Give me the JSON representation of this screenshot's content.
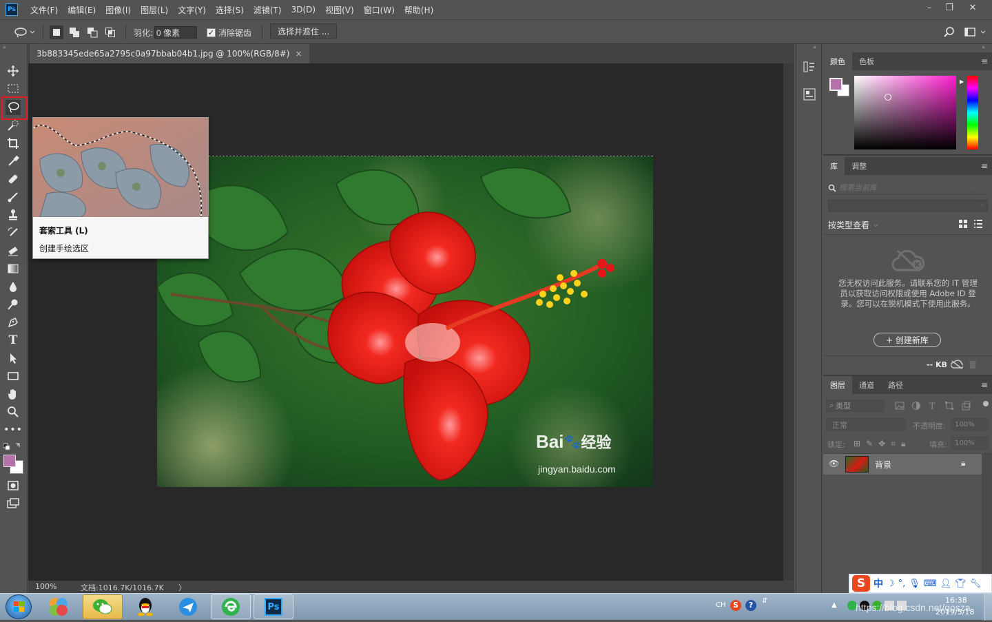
{
  "menubar": {
    "logo": "Ps",
    "items": [
      "文件(F)",
      "编辑(E)",
      "图像(I)",
      "图层(L)",
      "文字(Y)",
      "选择(S)",
      "滤镜(T)",
      "3D(D)",
      "视图(V)",
      "窗口(W)",
      "帮助(H)"
    ],
    "window_controls": [
      "–",
      "❐",
      "✕"
    ]
  },
  "options": {
    "feather_label": "羽化:",
    "feather_value": "0 像素",
    "antialias_label": "消除锯齿",
    "antialias_checked": true,
    "select_mask_button": "选择并遮住 ..."
  },
  "document": {
    "tab_title": "3b883345ede65a2795c0a97bbab04b1.jpg @ 100%(RGB/8#)",
    "tab_close": "×",
    "zoom": "100%",
    "doc_info": "文档:1016.7K/1016.7K",
    "status_arrow": "〉"
  },
  "tooltip": {
    "title": "套索工具 (L)",
    "description": "创建手绘选区"
  },
  "watermark": {
    "brand_left": "Bai",
    "brand_paw": "🐾",
    "brand_right": "经验",
    "url": "jingyan.baidu.com"
  },
  "color_panel": {
    "tabs": [
      "颜色",
      "色板"
    ],
    "foreground": "#b472a8",
    "background": "#ffffff"
  },
  "library_panel": {
    "tabs": [
      "库",
      "调整"
    ],
    "search_placeholder": "搜索当前库",
    "view_label": "按类型查看",
    "message": "您无权访问此服务。请联系您的 IT 管理员以获取访问权限或使用 Adobe ID 登录。您可以在脱机模式下使用此服务。",
    "create_button": "+ 创建新库",
    "size": "-- KB"
  },
  "layers_panel": {
    "tabs": [
      "图层",
      "通道",
      "路径"
    ],
    "filter_label": "类型",
    "blend_mode": "正常",
    "opacity_label": "不透明度:",
    "opacity_value": "100%",
    "lock_label": "锁定:",
    "fill_label": "填充:",
    "fill_value": "100%",
    "layers": [
      {
        "name": "背景",
        "visible": true,
        "locked": true
      }
    ]
  },
  "taskbar": {
    "tray_lang": "CH",
    "clock_time": "16:38",
    "clock_date": "2019/5/18",
    "url_overlay": "https://blog.csdn.net/gosza"
  },
  "ime": {
    "lang": "中"
  },
  "colors": {
    "ui_bg": "#535353",
    "canvas_bg": "#282828",
    "highlight_red": "#e02020",
    "accent_blue": "#31a8ff"
  }
}
